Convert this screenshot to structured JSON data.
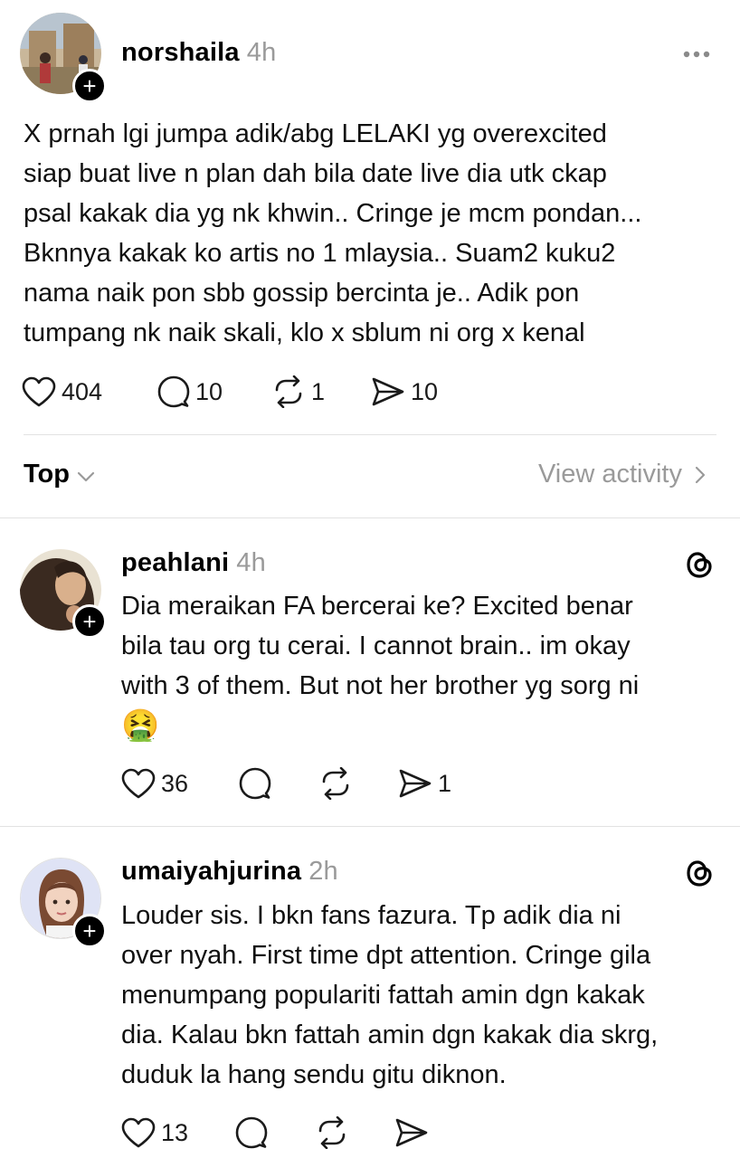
{
  "post": {
    "username": "norshaila",
    "time": "4h",
    "body": "X prnah lgi jumpa adik/abg LELAKI yg overexcited\nsiap buat live n plan dah bila date live dia utk ckap\npsal kakak dia yg nk khwin.. Cringe je mcm pondan...\nBknnya kakak ko artis no 1 mlaysia.. Suam2 kuku2\nnama naik pon sbb gossip bercinta je.. Adik pon\ntumpang nk naik skali, klo x sblum ni org x kenal",
    "likes": "404",
    "replies": "10",
    "reposts": "1",
    "shares": "10"
  },
  "sort_bar": {
    "sort_label": "Top",
    "view_activity_label": "View activity"
  },
  "replies": [
    {
      "username": "peahlani",
      "time": "4h",
      "body": "Dia meraikan FA bercerai ke? Excited benar\nbila tau org tu cerai. I cannot brain.. im okay\nwith 3 of them. But not her brother yg sorg ni",
      "emoji": "🤮",
      "likes": "36",
      "shares": "1"
    },
    {
      "username": "umaiyahjurina",
      "time": "2h",
      "body": "Louder sis. I bkn fans fazura. Tp adik dia ni\nover nyah. First time dpt attention. Cringe gila\nmenumpang populariti fattah amin dgn kakak\ndia. Kalau bkn fattah amin dgn kakak dia skrg,\nduduk la hang sendu gitu diknon.",
      "likes": "13"
    }
  ],
  "icons": {
    "like": "heart-icon",
    "reply": "speech-bubble-icon",
    "repost": "repost-arrows-icon",
    "share": "paper-plane-icon",
    "more": "ellipsis-icon",
    "threads": "threads-logo-icon",
    "follow": "plus-icon"
  }
}
